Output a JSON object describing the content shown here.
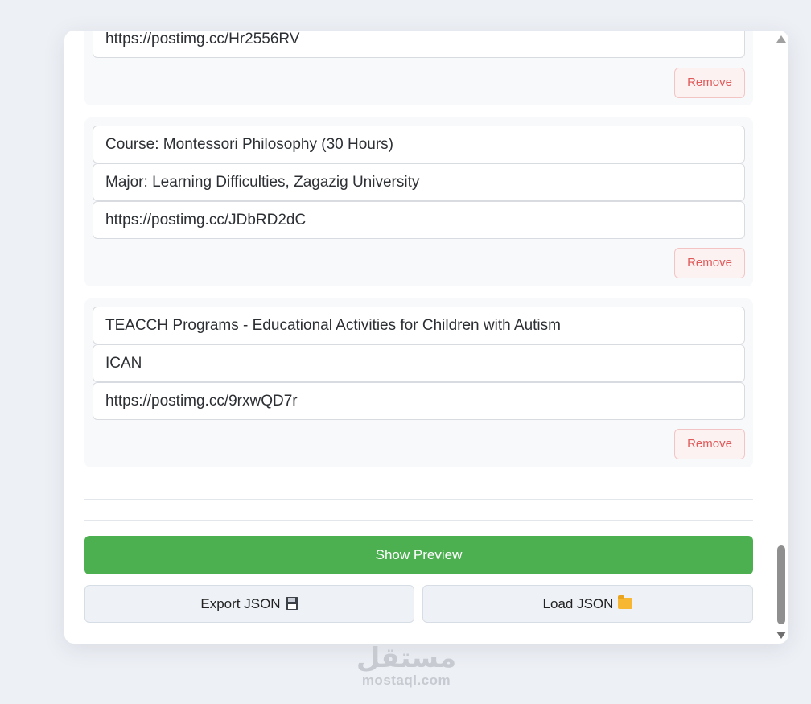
{
  "entries": [
    {
      "fields": [
        "https://postimg.cc/Hr2556RV"
      ],
      "remove_label": "Remove"
    },
    {
      "fields": [
        "Course: Montessori Philosophy (30 Hours)",
        "Major: Learning Difficulties, Zagazig University",
        "https://postimg.cc/JDbRD2dC"
      ],
      "remove_label": "Remove"
    },
    {
      "fields": [
        "TEACCH Programs - Educational Activities for Children with Autism",
        "ICAN",
        "https://postimg.cc/9rxwQD7r"
      ],
      "remove_label": "Remove"
    }
  ],
  "actions": {
    "show_preview": "Show Preview",
    "export_json": "Export JSON",
    "load_json": "Load JSON",
    "export_icon": "floppy-disk-icon",
    "load_icon": "folder-icon"
  },
  "watermark": {
    "arabic": "مستقل",
    "latin": "mostaql.com"
  },
  "colors": {
    "primary_green": "#4caf50",
    "remove_red": "#e05a5a",
    "background": "#edf0f5"
  }
}
